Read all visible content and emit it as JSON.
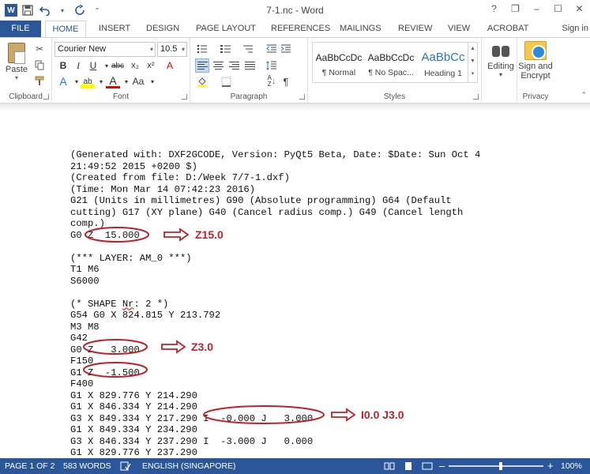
{
  "window": {
    "title": "7-1.nc - Word",
    "app_logo": "W",
    "help": "?",
    "restore": "❐",
    "minimize": "–",
    "maximize": "☐",
    "close": "✕"
  },
  "qat": {
    "save": "save-icon",
    "undo": "undo-icon",
    "redo": "redo-icon"
  },
  "tabs": [
    "FILE",
    "HOME",
    "INSERT",
    "DESIGN",
    "PAGE LAYOUT",
    "REFERENCES",
    "MAILINGS",
    "REVIEW",
    "VIEW",
    "ACROBAT"
  ],
  "sign_in": "Sign in",
  "ribbon": {
    "clipboard": {
      "label": "Clipboard",
      "paste": "Paste"
    },
    "font": {
      "label": "Font",
      "family": "Courier New",
      "size": "10.5",
      "grow": "A",
      "shrink": "A",
      "case": "Aa",
      "clear": "A",
      "bold": "B",
      "italic": "I",
      "underline": "U",
      "strike": "abc",
      "subscript": "x₂",
      "superscript": "x²",
      "effects": "A",
      "highlight": "ab",
      "color": "A",
      "changecase": "Aa"
    },
    "paragraph": {
      "label": "Paragraph",
      "pilcrow": "¶",
      "sort": "↓"
    },
    "styles": {
      "label": "Styles",
      "items": [
        {
          "preview": "AaBbCcDc",
          "name": "¶ Normal"
        },
        {
          "preview": "AaBbCcDc",
          "name": "¶ No Spac..."
        },
        {
          "preview": "AaBbCc",
          "name": "Heading 1"
        }
      ]
    },
    "editing": {
      "label": "Editing"
    },
    "privacy": {
      "label": "Privacy",
      "sign_line1": "Sign and",
      "sign_line2": "Encrypt"
    }
  },
  "document": {
    "lines": [
      "(Generated with: DXF2GCODE, Version: PyQt5 Beta, Date: $Date: Sun Oct 4",
      "21:49:52 2015 +0200 $)",
      "(Created from file: D:/Week 7/7-1.dxf)",
      "(Time: Mon Mar 14 07:42:23 2016)",
      "G21 (Units in millimetres) G90 (Absolute programming) G64 (Default",
      "cutting) G17 (XY plane) G40 (Cancel radius comp.) G49 (Cancel length",
      "comp.)",
      "G0 Z  15.000",
      "",
      "(*** LAYER: AM_0 ***)",
      "T1 M6",
      "S6000",
      "",
      "(* SHAPE Nr: 2 *)",
      "G54 G0 X 824.815 Y 213.792",
      "M3 M8",
      "G42",
      "G0 Z   3.000",
      "F150",
      "G1 Z  -1.500",
      "F400",
      "G1 X 829.776 Y 214.290",
      "G1 X 846.334 Y 214.290",
      "G3 X 849.334 Y 217.290 I  -0.000 J   3.000",
      "G1 X 849.334 Y 234.290",
      "G3 X 846.334 Y 237.290 I  -3.000 J   0.000",
      "G1 X 829.776 Y 237.290"
    ],
    "annotations": [
      "Z15.0",
      "Z3.0",
      "I0.0 J3.0"
    ]
  },
  "status": {
    "page": "PAGE 1 OF 2",
    "words": "583 WORDS",
    "language": "ENGLISH (SINGAPORE)",
    "zoom": "100%",
    "zoom_minus": "–",
    "zoom_plus": "+"
  }
}
